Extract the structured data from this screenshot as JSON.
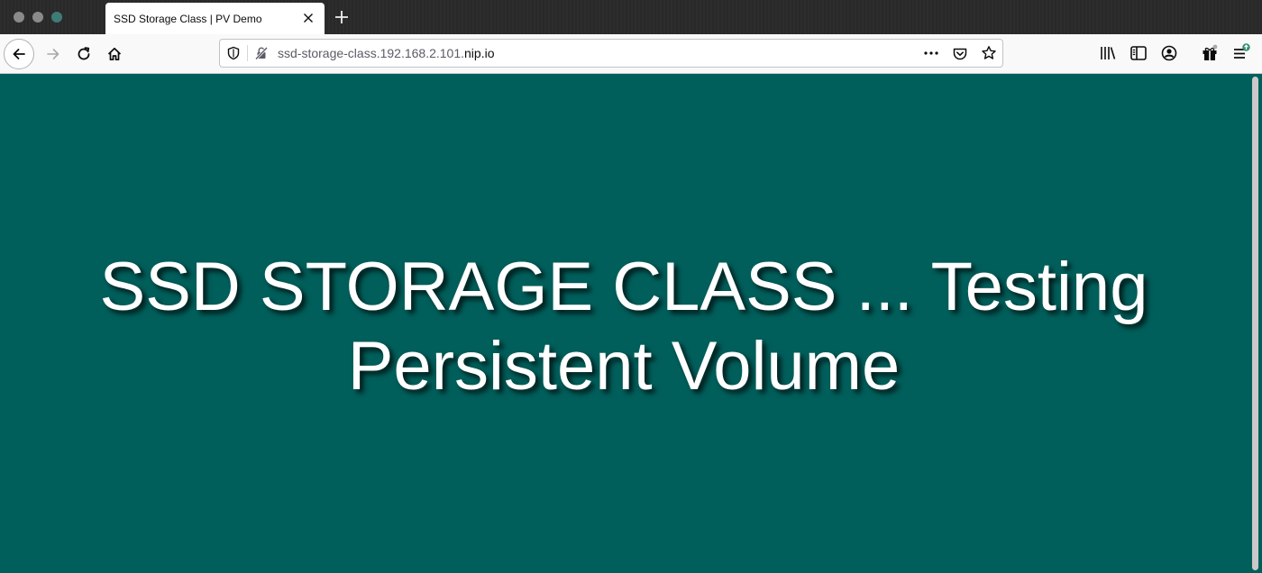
{
  "browser": {
    "tab": {
      "title": "SSD Storage Class | PV Demo"
    },
    "url": {
      "prefix": "ssd-storage-class.192.168.2.101.",
      "host": "nip.io"
    },
    "icons": {
      "back": "back-arrow-icon",
      "forward": "forward-arrow-icon",
      "reload": "reload-icon",
      "home": "home-icon",
      "tracking": "shield-icon",
      "connection": "insecure-lock-icon",
      "page_actions": "more-horizontal-icon",
      "pocket": "pocket-icon",
      "bookmark": "star-icon",
      "library": "library-icon",
      "sidebar": "sidebar-icon",
      "account": "account-icon",
      "whats_new": "gift-icon",
      "menu": "hamburger-menu-icon"
    }
  },
  "page": {
    "headline_line1": "SSD STORAGE CLASS ... Testing",
    "headline_line2": "Persistent Volume"
  },
  "colors": {
    "page_background": "#015f5b",
    "headline_text": "#ffffff"
  }
}
